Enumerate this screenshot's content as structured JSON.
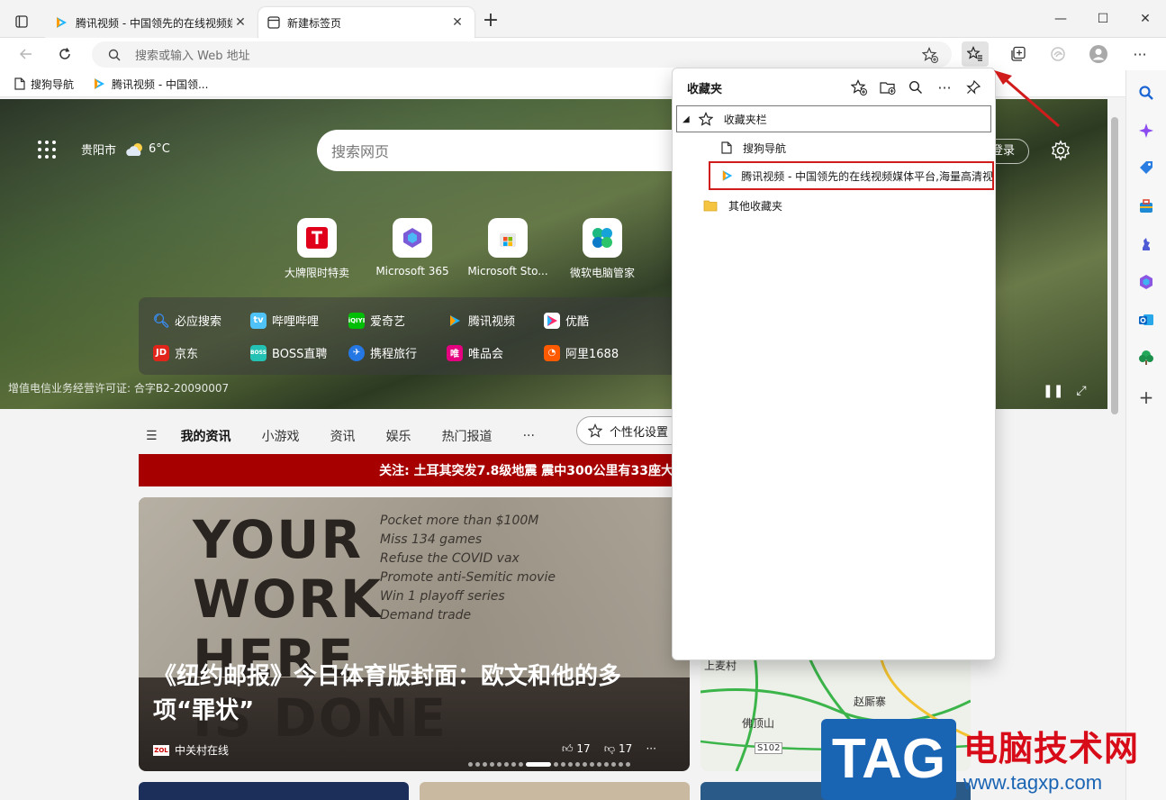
{
  "tabs": [
    {
      "title": "腾讯视频 - 中国领先的在线视频媒",
      "active": false
    },
    {
      "title": "新建标签页",
      "active": true
    }
  ],
  "toolbar": {
    "address_placeholder": "搜索或输入 Web 地址"
  },
  "bookmarks_bar": [
    {
      "label": "搜狗导航"
    },
    {
      "label": "腾讯视频 - 中国领..."
    }
  ],
  "new_tab_page": {
    "weather": {
      "city": "贵阳市",
      "temperature": "6°C"
    },
    "search_placeholder": "搜索网页",
    "login_label": "登录",
    "quick_links": [
      {
        "label": "大牌限时特卖"
      },
      {
        "label": "Microsoft 365"
      },
      {
        "label": "Microsoft Sto..."
      },
      {
        "label": "微软电脑管家"
      }
    ],
    "hot_links_row1": [
      "必应搜索",
      "哔哩哔哩",
      "爱奇艺",
      "腾讯视频",
      "优酷"
    ],
    "hot_links_row2": [
      "京东",
      "BOSS直聘",
      "携程旅行",
      "唯品会",
      "阿里1688"
    ],
    "license": "增值电信业务经营许可证: 合字B2-20090007",
    "feed_tabs": [
      "我的资讯",
      "小游戏",
      "资讯",
      "娱乐",
      "热门报道",
      "···"
    ],
    "personalize_label": "个性化设置",
    "banner": "关注: 土耳其突发7.8级地震 震中300公里有33座大",
    "news": {
      "headline": "《纽约邮报》今日体育版封面：欧文和他的多项“罪状”",
      "source": "中关村在线",
      "likes": "17",
      "dislikes": "17",
      "paper_words": "YOUR\nWORK\nHERE\nIS DONE",
      "paper_list": [
        "Pocket more than $100M",
        "Miss 134 games",
        "Refuse the COVID vax",
        "Promote anti-Semitic movie",
        "Win 1 playoff series",
        "Demand trade"
      ]
    },
    "map_labels": [
      "上麦村",
      "赵厮寨",
      "佛顶山",
      "S102"
    ]
  },
  "favorites_panel": {
    "title": "收藏夹",
    "items": [
      {
        "label": "收藏夹栏",
        "type": "folder-root"
      },
      {
        "label": "搜狗导航",
        "type": "page"
      },
      {
        "label": "腾讯视频 - 中国领先的在线视频媒体平台,海量高清视",
        "type": "page"
      },
      {
        "label": "其他收藏夹",
        "type": "folder"
      }
    ]
  },
  "watermark": {
    "tag": "TAG",
    "cn": "电脑技术网",
    "url": "www.tagxp.com"
  },
  "colors": {
    "highlight_red": "#d11c1c",
    "banner_red": "#a60000",
    "edge_blue": "#1a64b4"
  }
}
